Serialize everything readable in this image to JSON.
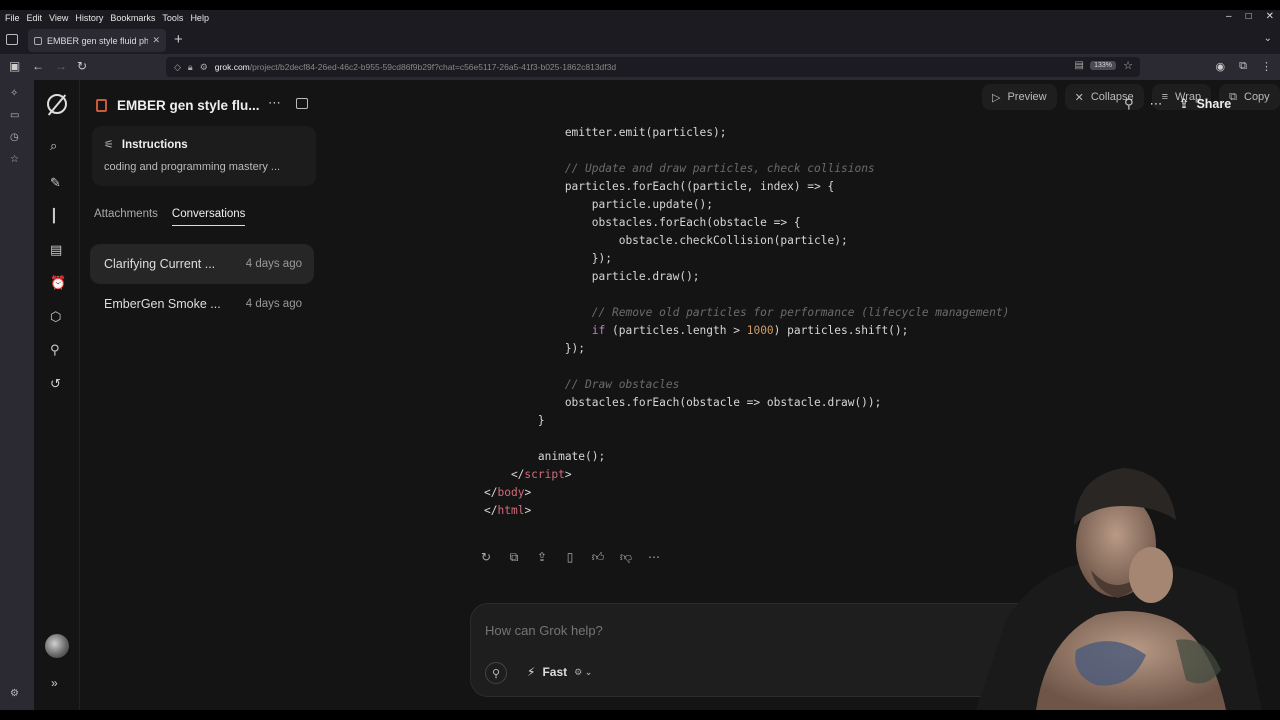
{
  "browser": {
    "menu": [
      "File",
      "Edit",
      "View",
      "History",
      "Bookmarks",
      "Tools",
      "Help"
    ],
    "tab": {
      "title": "EMBER gen style fluid physi"
    },
    "url": {
      "host": "grok.com",
      "path": "/project/b2decf84-26ed-46c2-b955-59cd86f9b29f?chat=c56e5117-26a5-41f3-b025-1862c813df3d"
    },
    "zoom": "133%"
  },
  "app": {
    "project_title": "EMBER gen style flu...",
    "instructions": {
      "heading": "Instructions",
      "text": "coding and programming mastery ..."
    },
    "subtabs": [
      "Attachments",
      "Conversations"
    ],
    "conversations": [
      {
        "title": "Clarifying Current ...",
        "time": "4 days ago"
      },
      {
        "title": "EmberGen Smoke ...",
        "time": "4 days ago"
      }
    ],
    "code_toolbar": {
      "preview": "Preview",
      "collapse": "Collapse",
      "wrap": "Wrap",
      "copy": "Copy"
    },
    "share_label": "Share",
    "composer": {
      "placeholder": "How can Grok help?",
      "model": "Fast"
    }
  },
  "code_lines": [
    [
      [
        "plain",
        "            emitter.emit(particles);"
      ]
    ],
    [
      [
        "plain",
        ""
      ]
    ],
    [
      [
        "plain",
        "            "
      ],
      [
        "comment",
        "// Update and draw particles, check collisions"
      ]
    ],
    [
      [
        "plain",
        "            particles.forEach((particle, index) => {"
      ]
    ],
    [
      [
        "plain",
        "                particle.update();"
      ]
    ],
    [
      [
        "plain",
        "                obstacles.forEach(obstacle => {"
      ]
    ],
    [
      [
        "plain",
        "                    obstacle.checkCollision(particle);"
      ]
    ],
    [
      [
        "plain",
        "                });"
      ]
    ],
    [
      [
        "plain",
        "                particle.draw();"
      ]
    ],
    [
      [
        "plain",
        ""
      ]
    ],
    [
      [
        "plain",
        "                "
      ],
      [
        "comment",
        "// Remove old particles for performance (lifecycle management)"
      ]
    ],
    [
      [
        "plain",
        "                "
      ],
      [
        "keyword",
        "if"
      ],
      [
        "plain",
        " (particles.length > "
      ],
      [
        "number",
        "1000"
      ],
      [
        "plain",
        ") particles.shift();"
      ]
    ],
    [
      [
        "plain",
        "            });"
      ]
    ],
    [
      [
        "plain",
        ""
      ]
    ],
    [
      [
        "plain",
        "            "
      ],
      [
        "comment",
        "// Draw obstacles"
      ]
    ],
    [
      [
        "plain",
        "            obstacles.forEach(obstacle => obstacle.draw());"
      ]
    ],
    [
      [
        "plain",
        "        }"
      ]
    ],
    [
      [
        "plain",
        ""
      ]
    ],
    [
      [
        "plain",
        "        animate();"
      ]
    ],
    [
      [
        "plain",
        "    </"
      ],
      [
        "tag",
        "script"
      ],
      [
        "plain",
        ">"
      ]
    ],
    [
      [
        "plain",
        "</"
      ],
      [
        "tag",
        "body"
      ],
      [
        "plain",
        ">"
      ]
    ],
    [
      [
        "plain",
        "</"
      ],
      [
        "tag",
        "html"
      ],
      [
        "plain",
        ">"
      ]
    ]
  ]
}
